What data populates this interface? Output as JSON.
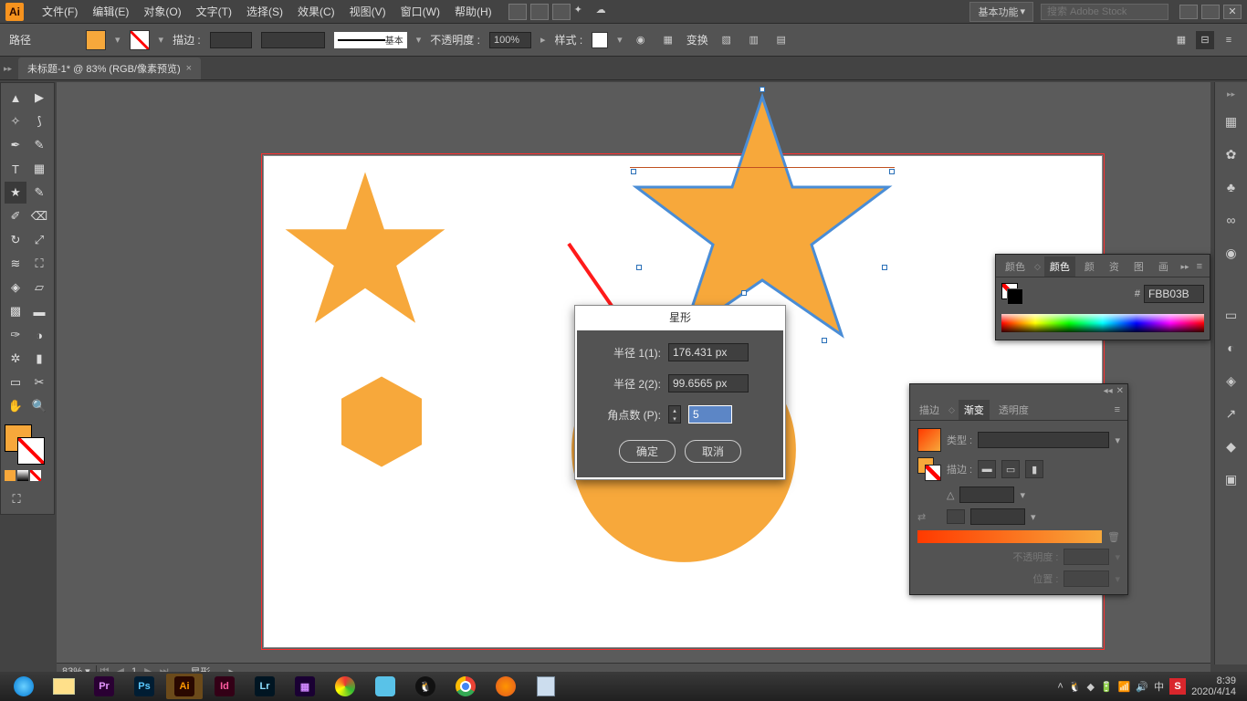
{
  "app": {
    "logo": "Ai"
  },
  "menu": {
    "file": "文件(F)",
    "edit": "编辑(E)",
    "object": "对象(O)",
    "text": "文字(T)",
    "select": "选择(S)",
    "effect": "效果(C)",
    "view": "视图(V)",
    "window": "窗口(W)",
    "help": "帮助(H)"
  },
  "topbar": {
    "workspace": "基本功能",
    "search_placeholder": "搜索 Adobe Stock"
  },
  "control": {
    "path_label": "路径",
    "stroke_label": "描边 :",
    "stroke_value": "",
    "brush_label": "基本",
    "opacity_label": "不透明度 :",
    "opacity_value": "100%",
    "style_label": "样式 :",
    "transform_label": "变换"
  },
  "document": {
    "tab": "未标题-1* @ 83% (RGB/像素预览)",
    "zoom": "83%"
  },
  "dialog": {
    "title": "星形",
    "radius1_label": "半径 1(1):",
    "radius1_value": "176.431 px",
    "radius2_label": "半径 2(2):",
    "radius2_value": "99.6565 px",
    "points_label": "角点数 (P):",
    "points_value": "5",
    "ok": "确定",
    "cancel": "取消"
  },
  "color_panel": {
    "tab_guide": "颜色",
    "tab_color": "颜色",
    "tab_other1": "颜",
    "tab_other2": "资",
    "tab_other3": "图",
    "tab_other4": "画",
    "hex_prefix": "#",
    "hex_value": "FBB03B"
  },
  "grad_panel": {
    "tab_stroke": "描边",
    "tab_grad": "渐变",
    "tab_trans": "透明度",
    "type_label": "类型 :",
    "stroke_label": "描边 :",
    "angle_symbol": "△",
    "opacity_label": "不透明度 :",
    "position_label": "位置 :"
  },
  "statusbar": {
    "nav_page": "1",
    "tool_name": "星形"
  },
  "taskbar": {
    "time": "8:39",
    "date": "2020/4/14"
  }
}
